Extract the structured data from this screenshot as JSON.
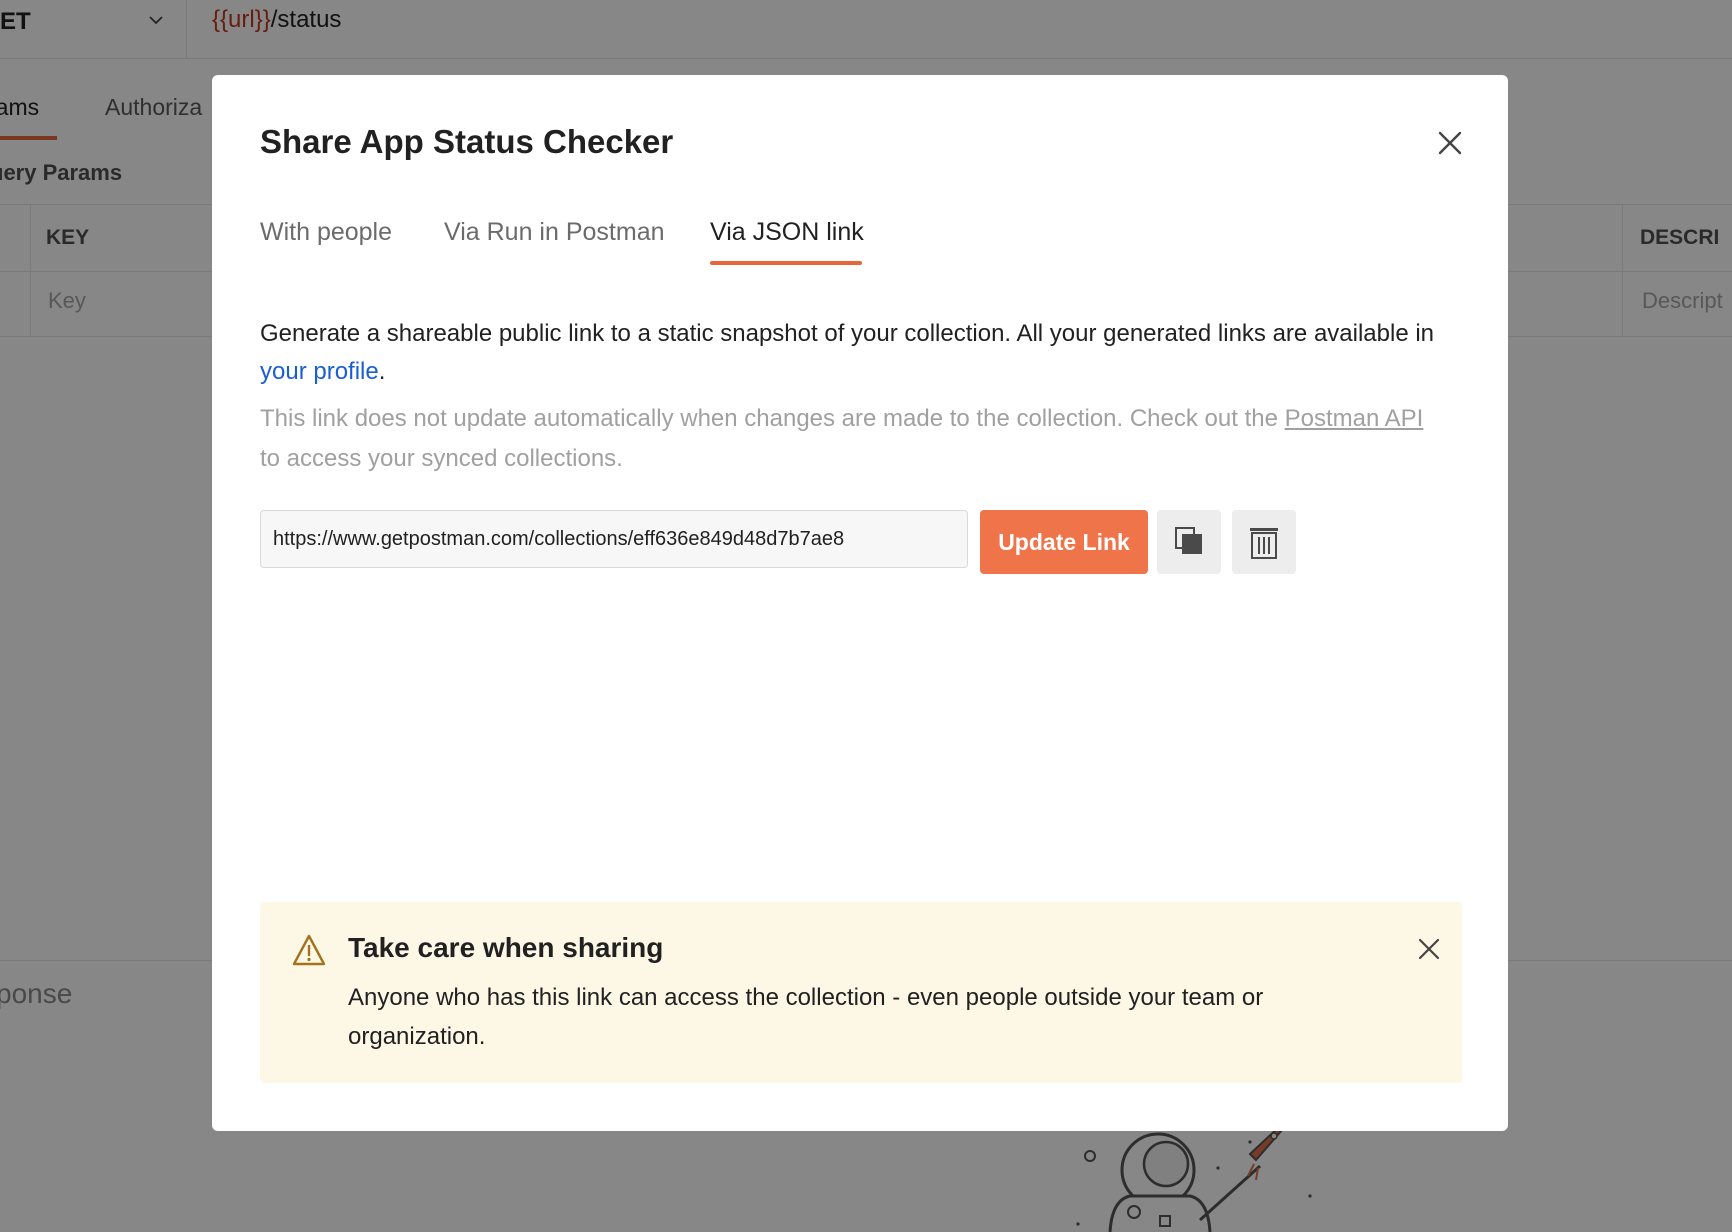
{
  "background": {
    "method": "ET",
    "url_variable": "{{url}}",
    "url_path": "/status",
    "tabs": [
      "rams",
      "Authoriza"
    ],
    "section_title": "uery Params",
    "columns": {
      "key": "KEY",
      "description": "DESCRI"
    },
    "placeholders": {
      "key": "Key",
      "description": "Descript"
    },
    "response_label": "sponse"
  },
  "modal": {
    "title": "Share App Status Checker",
    "tabs": [
      {
        "label": "With people",
        "active": false
      },
      {
        "label": "Via Run in Postman",
        "active": false
      },
      {
        "label": "Via JSON link",
        "active": true
      }
    ],
    "description": {
      "text": "Generate a shareable public link to a static snapshot of your collection. All your generated links are available in ",
      "link": "your profile",
      "suffix": "."
    },
    "note": {
      "text": "This link does not update automatically when changes are made to the collection. Check out the ",
      "link": "Postman API",
      "suffix": " to access your synced collections."
    },
    "link_field": {
      "value": "https://www.getpostman.com/collections/eff636e849d48d7b7ae8"
    },
    "update_button": "Update Link",
    "copy_icon": "copy-icon",
    "delete_icon": "trash-icon",
    "alert": {
      "title": "Take care when sharing",
      "body": "Anyone who has this link can access the collection - even people outside your team or organization.",
      "icon": "warning-icon"
    }
  },
  "colors": {
    "accent": "#f0744a",
    "tab_underline": "#e8663a",
    "link": "#1a5fcf",
    "alert_bg": "#fdf8e6",
    "warning": "#a3721f"
  }
}
